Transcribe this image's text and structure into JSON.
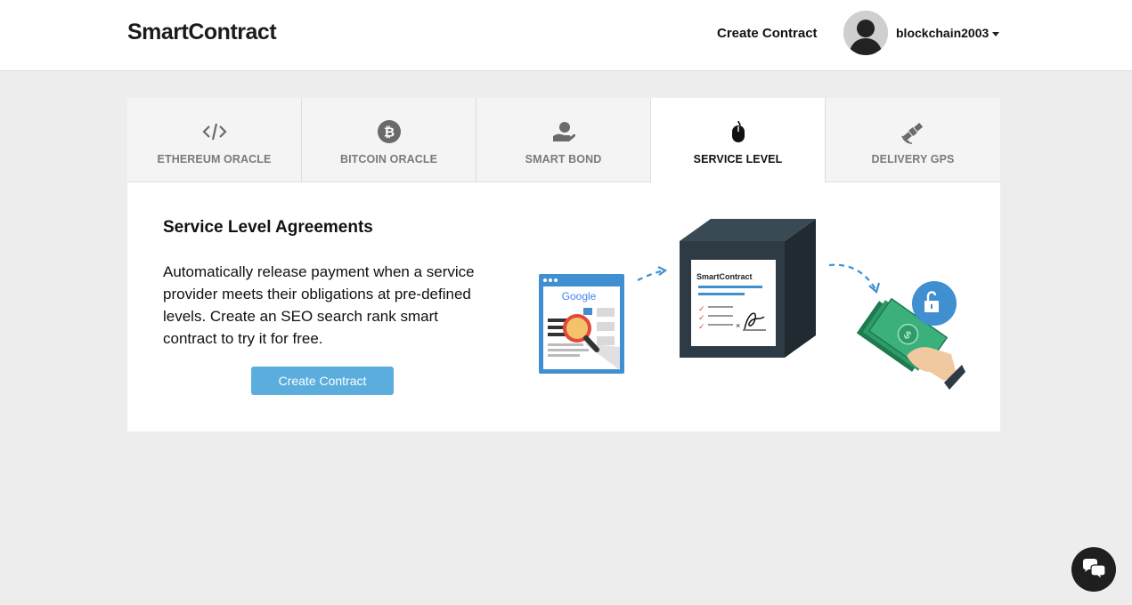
{
  "header": {
    "logo": "SmartContract",
    "nav_create": "Create Contract",
    "username": "blockchain2003"
  },
  "tabs": [
    {
      "label": "ETHEREUM ORACLE",
      "icon": "code-icon",
      "active": false
    },
    {
      "label": "BITCOIN ORACLE",
      "icon": "bitcoin-icon",
      "active": false
    },
    {
      "label": "SMART BOND",
      "icon": "coin-hand-icon",
      "active": false
    },
    {
      "label": "SERVICE LEVEL",
      "icon": "mouse-icon",
      "active": true
    },
    {
      "label": "DELIVERY GPS",
      "icon": "satellite-icon",
      "active": false
    }
  ],
  "content": {
    "title": "Service Level Agreements",
    "description": "Automatically release payment when a service provider meets their obligations at pre-defined levels. Create an SEO search rank smart contract to try it for free.",
    "cta": "Create Contract"
  },
  "illustration": {
    "search_brand": "Google",
    "box_brand": "SmartContract"
  },
  "colors": {
    "accent": "#5aaddc",
    "box": "#2e3b44",
    "money": "#2e9c6a"
  }
}
